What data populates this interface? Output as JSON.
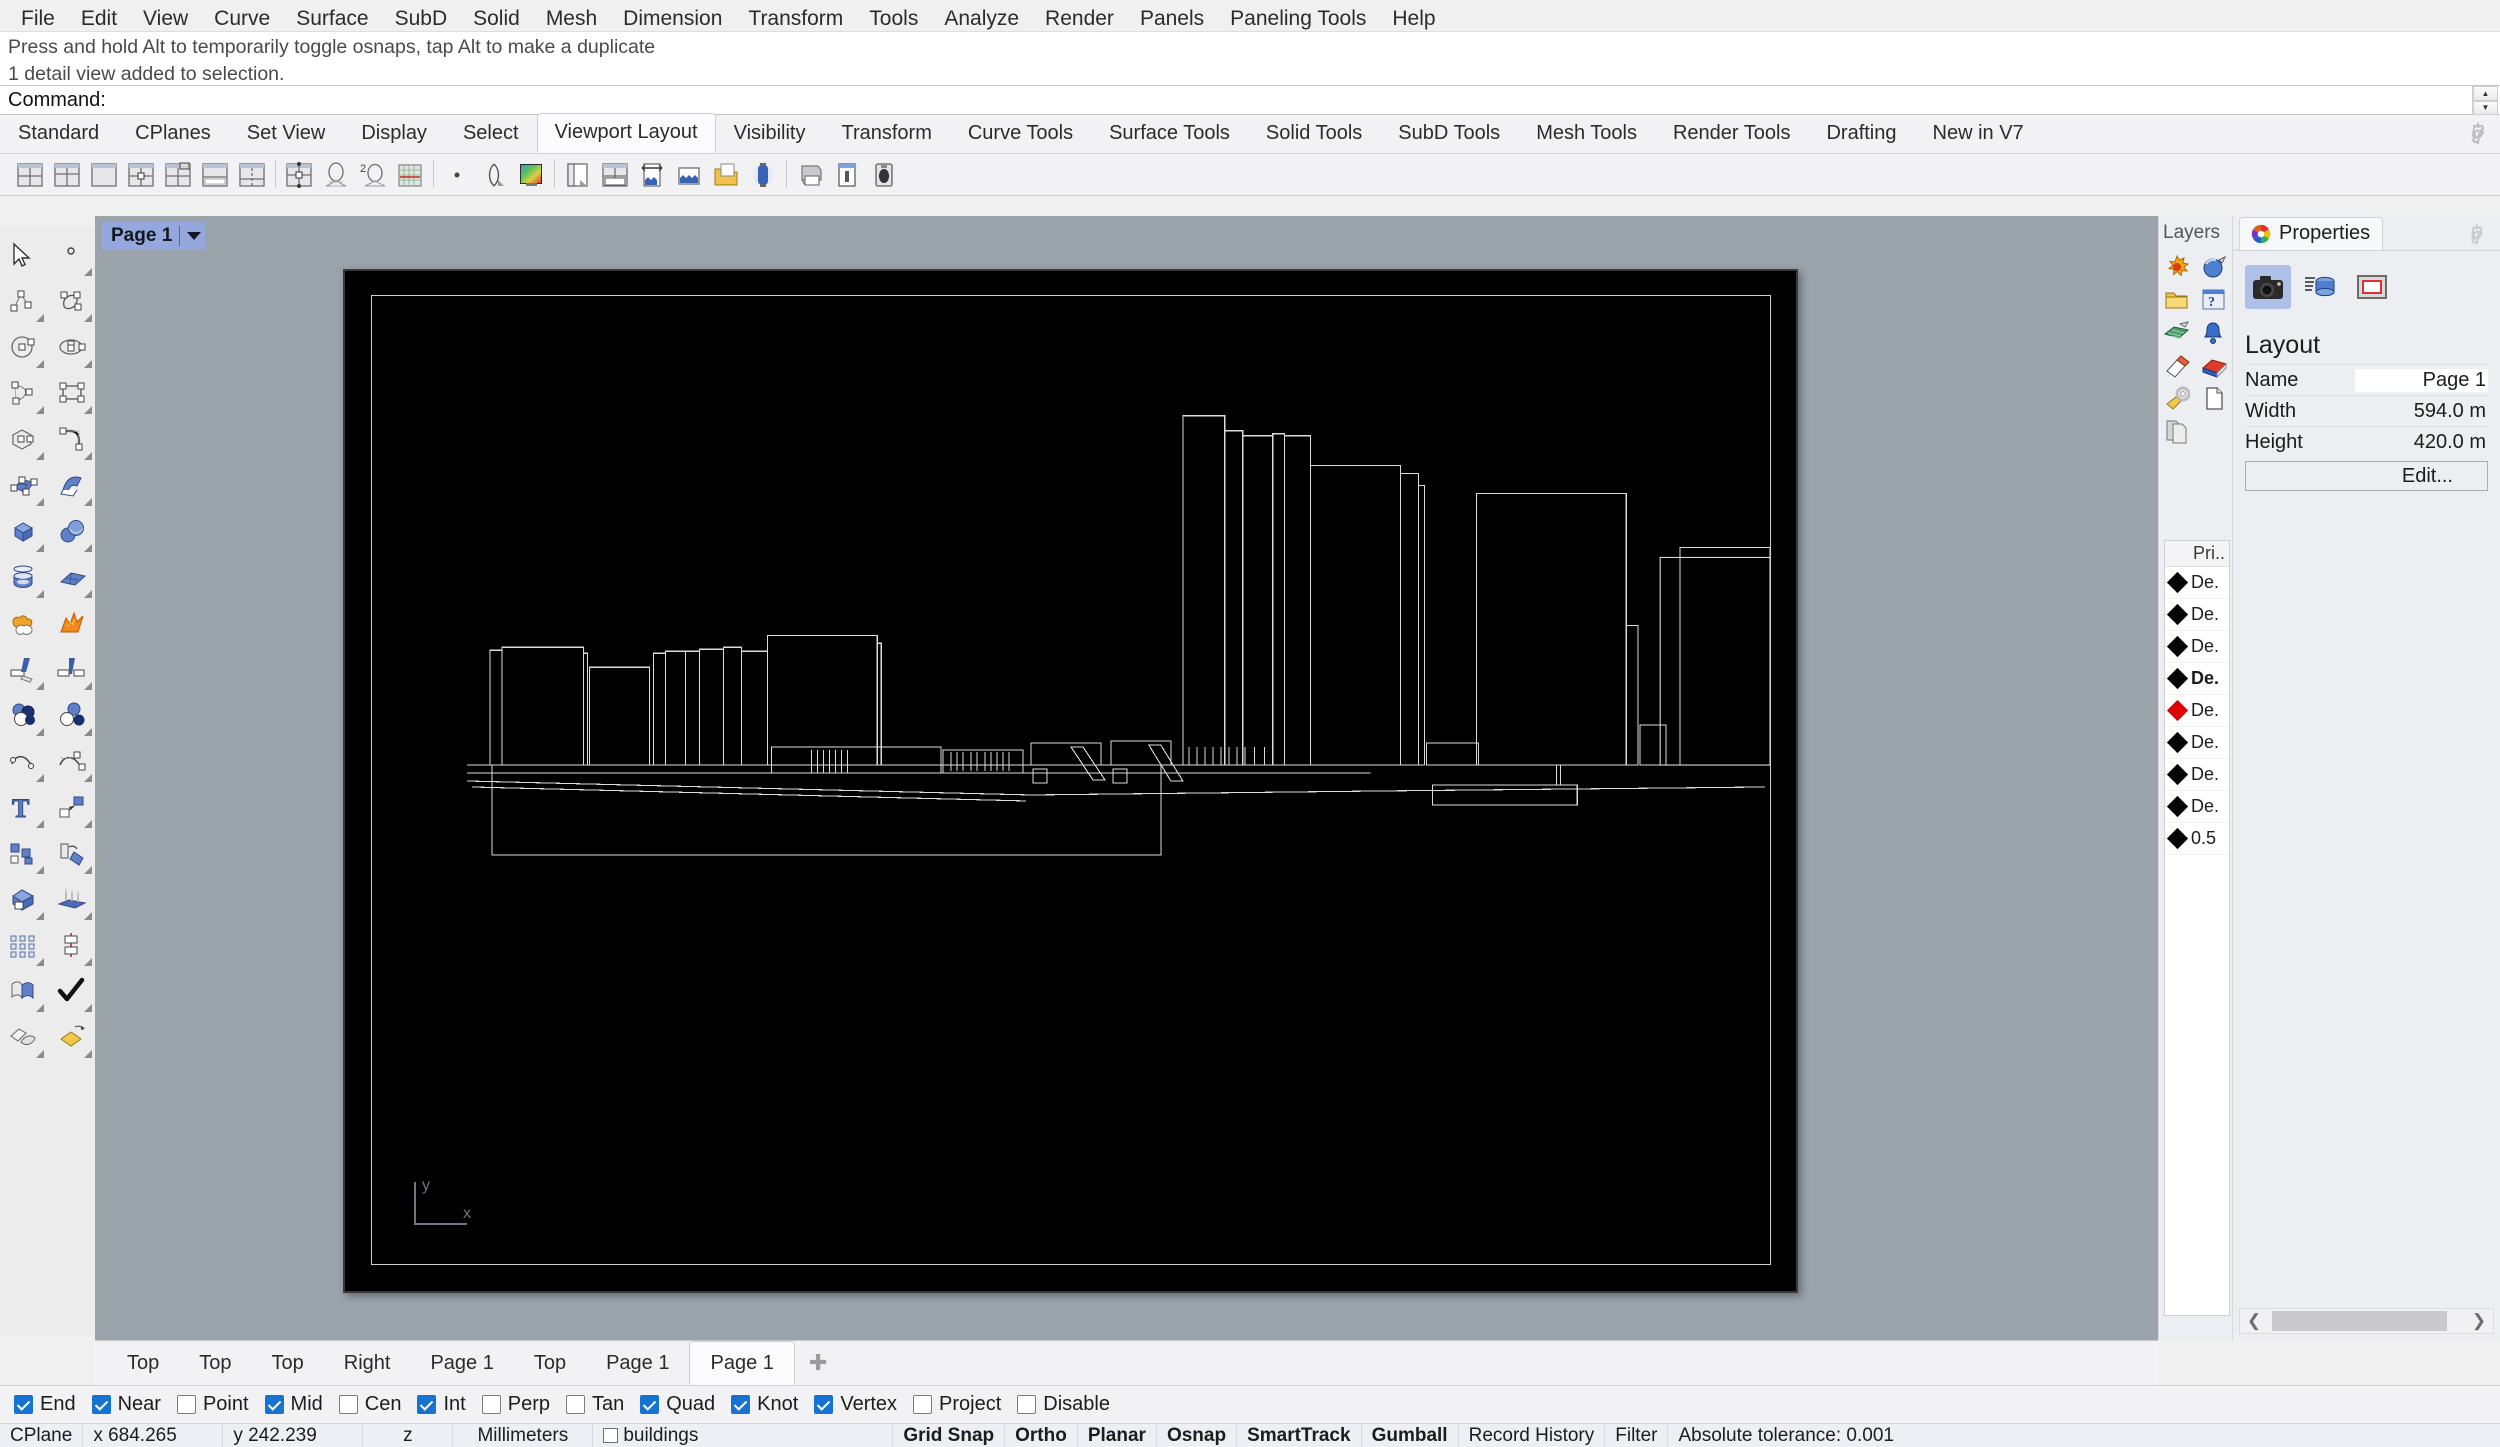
{
  "menubar": {
    "items": [
      "File",
      "Edit",
      "View",
      "Curve",
      "Surface",
      "SubD",
      "Solid",
      "Mesh",
      "Dimension",
      "Transform",
      "Tools",
      "Analyze",
      "Render",
      "Panels",
      "Paneling Tools",
      "Help"
    ]
  },
  "command_area": {
    "history": [
      "Press and hold Alt to temporarily toggle osnaps, tap Alt to make a duplicate",
      "1 detail view added to selection."
    ],
    "prompt_label": "Command:",
    "prompt_value": "",
    "scroll_up_icon": "triangle-up-icon",
    "scroll_down_icon": "triangle-down-icon"
  },
  "toolbar_tabs": {
    "items": [
      "Standard",
      "CPlanes",
      "Set View",
      "Display",
      "Select",
      "Viewport Layout",
      "Visibility",
      "Transform",
      "Curve Tools",
      "Surface Tools",
      "Solid Tools",
      "SubD Tools",
      "Mesh Tools",
      "Render Tools",
      "Drafting",
      "New in V7"
    ],
    "active": "Viewport Layout",
    "options_icon": "gear-icon"
  },
  "toolbar_top": {
    "buttons": [
      {
        "name": "viewport-4-standard-icon"
      },
      {
        "name": "viewport-4-split-icon"
      },
      {
        "name": "viewport-single-max-icon"
      },
      {
        "name": "viewport-4-named-icon"
      },
      {
        "name": "viewport-new-camera-icon"
      },
      {
        "name": "viewport-split-horizontal-icon"
      },
      {
        "name": "viewport-split-vertical-icon"
      },
      {
        "sep": true
      },
      {
        "name": "viewport-sync-icon"
      },
      {
        "name": "named-view-icon"
      },
      {
        "name": "named-view-2-icon"
      },
      {
        "name": "grid-settings-icon"
      },
      {
        "sep": true
      },
      {
        "name": "dot-icon"
      },
      {
        "name": "clipping-plane-icon"
      },
      {
        "name": "wallpaper-icon"
      },
      {
        "sep": true
      },
      {
        "name": "layout-new-icon"
      },
      {
        "name": "layout-detail-icon"
      },
      {
        "name": "detail-scale-icon"
      },
      {
        "name": "detail-lock-icon"
      },
      {
        "name": "page-folder-icon"
      },
      {
        "name": "detail-activate-icon"
      },
      {
        "sep": true
      },
      {
        "name": "print-icon"
      },
      {
        "name": "print-preview-icon"
      },
      {
        "name": "print-display-icon"
      }
    ]
  },
  "toolbar_left": {
    "buttons": [
      {
        "name": "select-arrow-icon",
        "flyout": false
      },
      {
        "name": "point-icon",
        "flyout": true
      },
      {
        "name": "polyline-icon",
        "flyout": true
      },
      {
        "name": "curve-interpolate-icon",
        "flyout": true
      },
      {
        "name": "circle-icon",
        "flyout": true
      },
      {
        "name": "ellipse-icon",
        "flyout": true
      },
      {
        "name": "arc-icon",
        "flyout": true
      },
      {
        "name": "rectangle-icon",
        "flyout": true
      },
      {
        "name": "polygon-icon",
        "flyout": true
      },
      {
        "name": "curve-fillet-icon",
        "flyout": true
      },
      {
        "name": "surface-from-points-icon",
        "flyout": true
      },
      {
        "name": "surface-loft-icon",
        "flyout": true
      },
      {
        "name": "box-icon",
        "flyout": true
      },
      {
        "name": "sphere-icon",
        "flyout": true
      },
      {
        "name": "cylinder-icon",
        "flyout": true
      },
      {
        "name": "surface-planar-icon",
        "flyout": true
      },
      {
        "name": "boolean-union-icon",
        "flyout": false
      },
      {
        "name": "explode-icon",
        "flyout": false
      },
      {
        "name": "trim-icon",
        "flyout": true
      },
      {
        "name": "split-icon",
        "flyout": true
      },
      {
        "name": "boolean-spheres-icon",
        "flyout": true
      },
      {
        "name": "boolean-difference-icon",
        "flyout": true
      },
      {
        "name": "curve-edit-points-icon",
        "flyout": true
      },
      {
        "name": "rebuild-curve-icon",
        "flyout": true
      },
      {
        "name": "text-icon",
        "flyout": true
      },
      {
        "name": "move-icon",
        "flyout": true
      },
      {
        "name": "copy-icon",
        "flyout": true
      },
      {
        "name": "rotate-icon",
        "flyout": true
      },
      {
        "name": "box-edit-icon",
        "flyout": true
      },
      {
        "name": "extrude-icon",
        "flyout": true
      },
      {
        "name": "array-icon",
        "flyout": true
      },
      {
        "name": "mirror-icon",
        "flyout": true
      },
      {
        "name": "offset-surface-icon",
        "flyout": true
      },
      {
        "name": "check-object-icon",
        "flyout": true
      },
      {
        "name": "mesh-from-surface-icon",
        "flyout": true
      },
      {
        "name": "render-material-icon",
        "flyout": true
      }
    ]
  },
  "canvas": {
    "page_tab": {
      "label": "Page 1",
      "caret_icon": "chevron-down-icon"
    },
    "axis_gizmo": {
      "x_label": "x",
      "y_label": "y"
    },
    "sheet_background": "#000000",
    "line_color": "#d8d8d8"
  },
  "viewport_tabs": {
    "items": [
      "Top",
      "Top",
      "Top",
      "Right",
      "Page 1",
      "Top",
      "Page 1",
      "Page 1"
    ],
    "active_index": 7,
    "add_icon": "plus-icon"
  },
  "layers_panel": {
    "title": "Layers",
    "tool_icons": [
      "new-layer-sun-icon",
      "layer-sphere-icon",
      "layer-folder-icon",
      "layer-help-icon",
      "layer-grid-icon",
      "layer-bell-icon",
      "layer-eraser-icon",
      "layer-material-icon",
      "layer-settings-icon",
      "layer-page-icon",
      "layer-pages-icon"
    ],
    "column_header": "Pri..",
    "rows": [
      {
        "swatch": "#000000",
        "label": "De.",
        "selected": false
      },
      {
        "swatch": "#000000",
        "label": "De.",
        "selected": false
      },
      {
        "swatch": "#000000",
        "label": "De.",
        "selected": false
      },
      {
        "swatch": "#000000",
        "label": "De.",
        "selected": true
      },
      {
        "swatch": "#e00000",
        "label": "De.",
        "selected": false
      },
      {
        "swatch": "#000000",
        "label": "De.",
        "selected": false
      },
      {
        "swatch": "#000000",
        "label": "De.",
        "selected": false
      },
      {
        "swatch": "#000000",
        "label": "De.",
        "selected": false
      },
      {
        "swatch": "#000000",
        "label": "0.5",
        "selected": false
      }
    ]
  },
  "properties_panel": {
    "tab_label": "Properties",
    "tab_icon": "color-wheel-icon",
    "options_icon": "gear-icon",
    "mode_buttons": [
      {
        "name": "camera-icon",
        "active": true
      },
      {
        "name": "object-database-icon",
        "active": false
      },
      {
        "name": "layout-page-icon",
        "active": false
      }
    ],
    "section_title": "Layout",
    "fields": [
      {
        "label": "Name",
        "value": "Page 1",
        "editable": true
      },
      {
        "label": "Width",
        "value": "594.0 m",
        "editable": false
      },
      {
        "label": "Height",
        "value": "420.0 m",
        "editable": false
      }
    ],
    "edit_button": "Edit...",
    "scroll_left_icon": "chevron-left-icon",
    "scroll_right_icon": "chevron-right-icon"
  },
  "osnap_bar": {
    "items": [
      {
        "label": "End",
        "checked": true
      },
      {
        "label": "Near",
        "checked": true
      },
      {
        "label": "Point",
        "checked": false
      },
      {
        "label": "Mid",
        "checked": true
      },
      {
        "label": "Cen",
        "checked": false
      },
      {
        "label": "Int",
        "checked": true
      },
      {
        "label": "Perp",
        "checked": false
      },
      {
        "label": "Tan",
        "checked": false
      },
      {
        "label": "Quad",
        "checked": true
      },
      {
        "label": "Knot",
        "checked": true
      },
      {
        "label": "Vertex",
        "checked": true
      },
      {
        "label": "Project",
        "checked": false
      },
      {
        "label": "Disable",
        "checked": false
      }
    ]
  },
  "status_bar": {
    "cplane_label": "CPlane",
    "x_value": "x 684.265",
    "y_value": "y 242.239",
    "z_value": "z",
    "units": "Millimeters",
    "layer_name": "buildings",
    "toggles": [
      "Grid Snap",
      "Ortho",
      "Planar",
      "Osnap",
      "SmartTrack",
      "Gumball"
    ],
    "record_history": "Record History",
    "filter": "Filter",
    "tolerance": "Absolute tolerance: 0.001"
  }
}
